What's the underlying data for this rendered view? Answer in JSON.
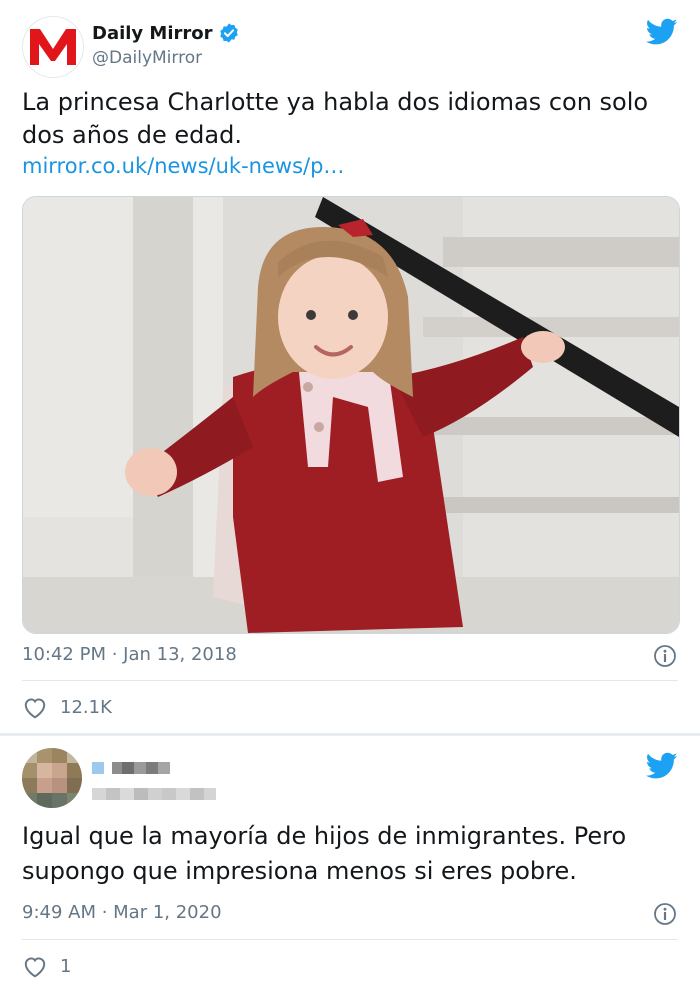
{
  "tweet1": {
    "author_name": "Daily Mirror",
    "author_handle": "@DailyMirror",
    "avatar_letter": "M",
    "text_line1": "La princesa Charlotte ya habla dos idiomas con solo",
    "text_line2": "dos años de edad.",
    "link": "mirror.co.uk/news/uk-news/p…",
    "timestamp": "10:42 PM · Jan 13, 2018",
    "likes": "12.1K"
  },
  "tweet2": {
    "text_line1": "Igual que la mayoría de hijos de inmigrantes. Pero",
    "text_line2": "supongo que impresiona menos si eres pobre.",
    "timestamp": "9:49 AM · Mar 1, 2020",
    "likes": "1"
  },
  "colors": {
    "brand_red": "#e0161b",
    "twitter_blue": "#1da1f2",
    "link_blue": "#1b95e0",
    "meta_gray": "#657786",
    "verified_blue": "#1da1f2"
  },
  "icons": [
    "verified-badge-icon",
    "twitter-bird-icon",
    "info-icon",
    "heart-icon"
  ]
}
